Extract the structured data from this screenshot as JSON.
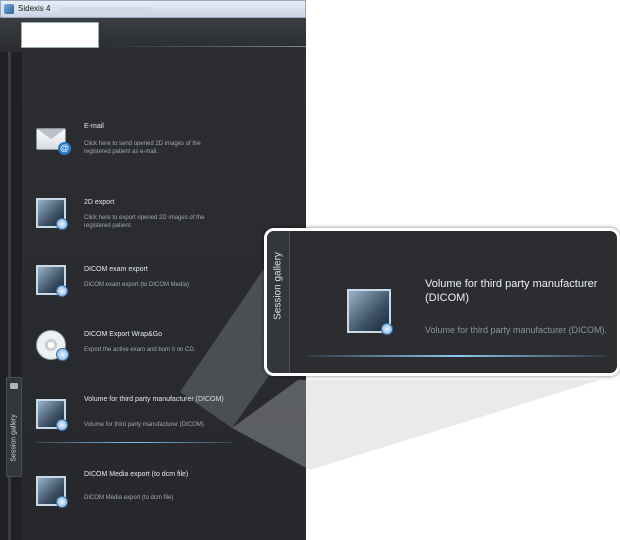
{
  "window": {
    "title": "Sidexis 4"
  },
  "sidebar_tab": {
    "label": "Session gallery"
  },
  "items": [
    {
      "icon": "email-icon",
      "title": "E-mail",
      "description": "Click here to send opened 2D images of the registered patient as e-mail."
    },
    {
      "icon": "image-export-icon",
      "title": "2D export",
      "description": "Click here to export opened 2D images of the registered patient."
    },
    {
      "icon": "dicom-export-icon",
      "title": "DICOM exam export",
      "description": "DICOM exam export (to DICOM Media)"
    },
    {
      "icon": "disc-icon",
      "title": "DICOM Export Wrap&Go",
      "description": "Export the active exam and burn it on CD."
    },
    {
      "icon": "volume-icon",
      "title": "Volume for third party manufacturer (DICOM)",
      "description": "Volume for third party manufacturer (DICOM).",
      "selected": true
    },
    {
      "icon": "dicom-media-icon",
      "title": "DICOM Media export (to dcm file)",
      "description": "DICOM Media export (to dcm file)"
    }
  ],
  "callout": {
    "tab_label": "Session gallery",
    "title": "Volume for third party manufacturer (DICOM)",
    "description": "Volume for third party manufacturer (DICOM)."
  },
  "colors": {
    "panel_bg": "#2b2d31",
    "selection_accent": "#7fc0f0",
    "item_title": "#e6e9ec",
    "item_desc": "#a3a8ae"
  }
}
